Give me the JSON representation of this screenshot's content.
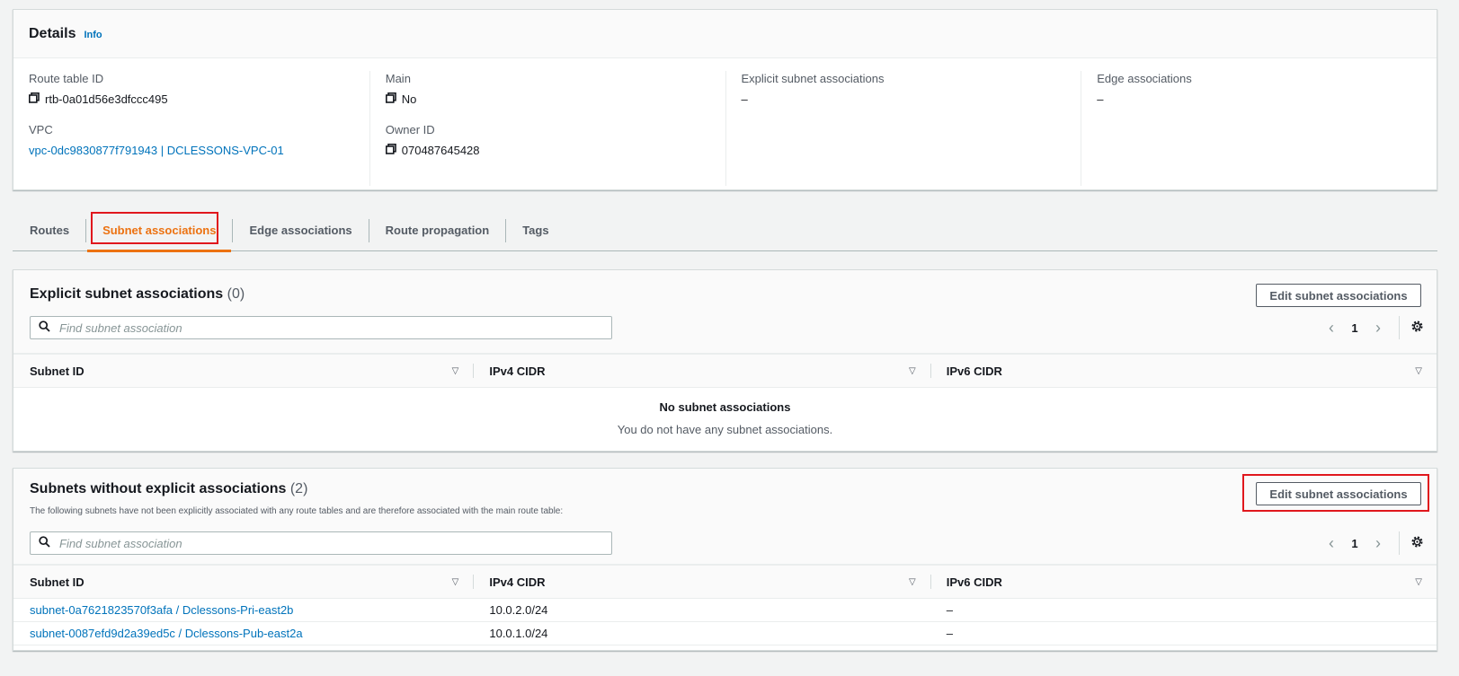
{
  "details": {
    "title": "Details",
    "info": "Info",
    "route_table_id_label": "Route table ID",
    "route_table_id": "rtb-0a01d56e3dfccc495",
    "vpc_label": "VPC",
    "vpc": "vpc-0dc9830877f791943 | DCLESSONS-VPC-01",
    "main_label": "Main",
    "main": "No",
    "owner_id_label": "Owner ID",
    "owner_id": "070487645428",
    "explicit_label": "Explicit subnet associations",
    "explicit": "–",
    "edge_label": "Edge associations",
    "edge": "–"
  },
  "tabs": [
    "Routes",
    "Subnet associations",
    "Edge associations",
    "Route propagation",
    "Tags"
  ],
  "explicit": {
    "title": "Explicit subnet associations",
    "count": "(0)",
    "button": "Edit subnet associations",
    "search_placeholder": "Find subnet association",
    "page": "1",
    "columns": [
      "Subnet ID",
      "IPv4 CIDR",
      "IPv6 CIDR"
    ],
    "empty_title": "No subnet associations",
    "empty_text": "You do not have any subnet associations."
  },
  "without": {
    "title": "Subnets without explicit associations",
    "count": "(2)",
    "description": "The following subnets have not been explicitly associated with any route tables and are therefore associated with the main route table:",
    "button": "Edit subnet associations",
    "search_placeholder": "Find subnet association",
    "page": "1",
    "columns": [
      "Subnet ID",
      "IPv4 CIDR",
      "IPv6 CIDR"
    ],
    "rows": [
      {
        "subnet": "subnet-0a7621823570f3afa / Dclessons-Pri-east2b",
        "ipv4": "10.0.2.0/24",
        "ipv6": "–"
      },
      {
        "subnet": "subnet-0087efd9d2a39ed5c / Dclessons-Pub-east2a",
        "ipv4": "10.0.1.0/24",
        "ipv6": "–"
      }
    ]
  },
  "icons": {
    "copy": "copy-icon",
    "search": "search-icon",
    "settings": "gear-icon",
    "sort": "sort-caret-icon"
  },
  "colors": {
    "link": "#0073bb",
    "active_tab": "#ec7211",
    "highlight": "#e0171d"
  }
}
